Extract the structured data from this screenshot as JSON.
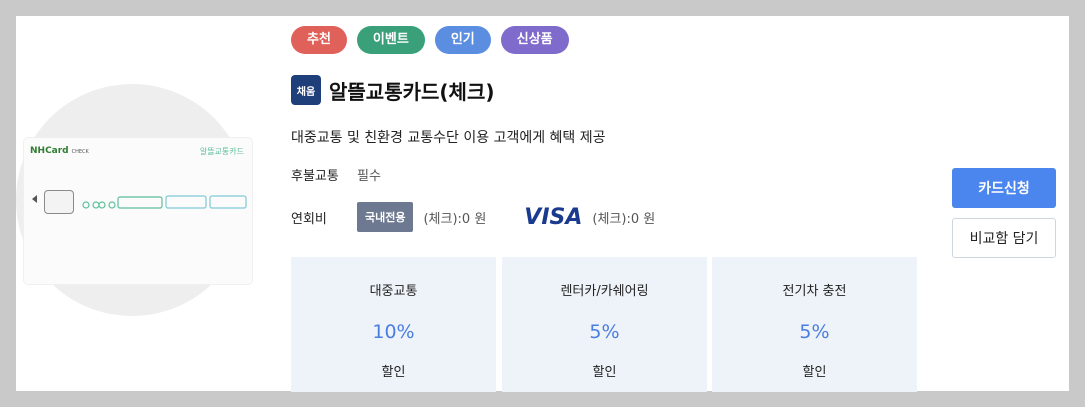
{
  "badges": [
    {
      "label": "추천",
      "color": "#e0605a"
    },
    {
      "label": "이벤트",
      "color": "#3aa07a"
    },
    {
      "label": "인기",
      "color": "#5b8ee0"
    },
    {
      "label": "신상품",
      "color": "#7f6bcc"
    }
  ],
  "bank_logo_text": "채움",
  "card": {
    "title": "알뜰교통카드(체크)",
    "description": "대중교통 및 친환경 교통수단 이용 고객에게 혜택 제공",
    "image": {
      "brand_left": "NHCard",
      "brand_left_sub": "CHECK",
      "brand_right": "알뜰교통카드"
    }
  },
  "requirement": {
    "label": "후불교통",
    "value": "필수"
  },
  "annual_fee": {
    "label": "연회비",
    "domestic_badge": "국내전용",
    "domestic_fee": "(체크):0 원",
    "visa_logo": "VISA",
    "visa_fee": "(체크):0 원"
  },
  "benefits": [
    {
      "name": "대중교통",
      "value": "10%",
      "unit": "할인"
    },
    {
      "name": "렌터카/카쉐어링",
      "value": "5%",
      "unit": "할인"
    },
    {
      "name": "전기차 충전",
      "value": "5%",
      "unit": "할인"
    }
  ],
  "buttons": {
    "apply": "카드신청",
    "compare": "비교함 담기"
  },
  "colors": {
    "accent": "#4a86ee",
    "benefit_value": "#4a7de0",
    "benefit_bg": "#eef3f9"
  }
}
